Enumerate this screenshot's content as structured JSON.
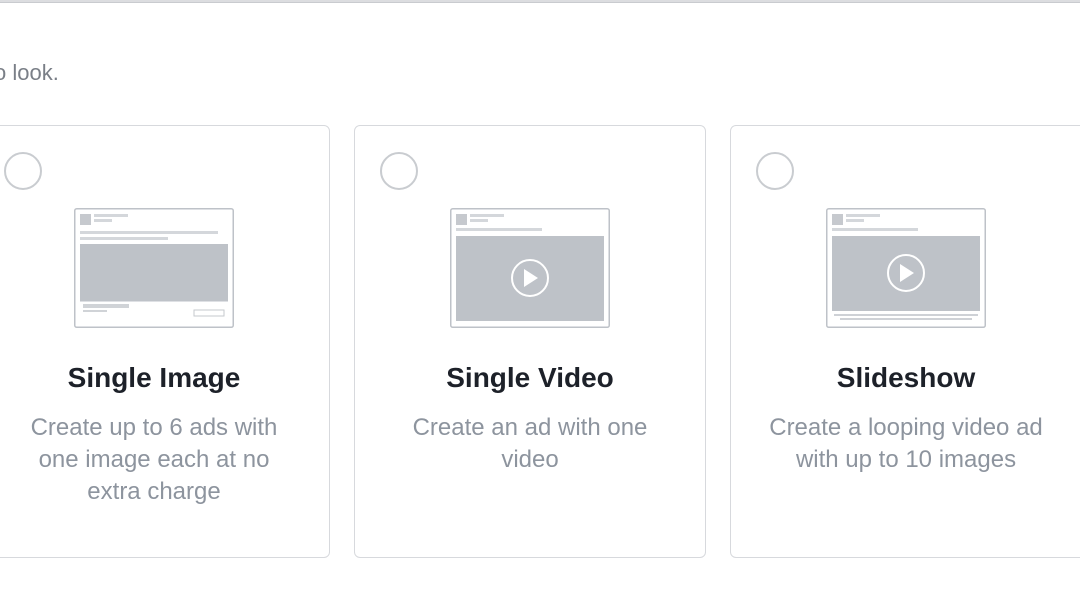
{
  "intro_text": "o look.",
  "cards": [
    {
      "title": "Single Image",
      "description": "Create up to 6 ads with one image each at no extra charge",
      "preview_icon": "single-image-preview",
      "selected": false
    },
    {
      "title": "Single Video",
      "description": "Create an ad with one video",
      "preview_icon": "single-video-preview",
      "selected": false
    },
    {
      "title": "Slideshow",
      "description": "Create a looping video ad with up to 10 images",
      "preview_icon": "slideshow-preview",
      "selected": false
    }
  ],
  "colors": {
    "card_border": "#d7d9dd",
    "title": "#1d2129",
    "description": "#8d949e",
    "preview_fill": "#bec2c8"
  }
}
